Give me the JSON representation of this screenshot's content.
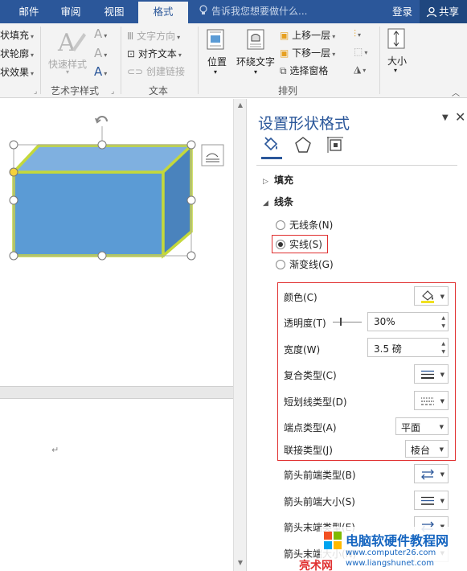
{
  "tabs": [
    {
      "label": "邮件",
      "active": false
    },
    {
      "label": "审阅",
      "active": false
    },
    {
      "label": "视图",
      "active": false
    },
    {
      "label": "格式",
      "active": true
    }
  ],
  "tell_me": "告诉我您想要做什么...",
  "login": "登录",
  "share": "共享",
  "ribbon": {
    "shape_styles": {
      "fill": "状填充",
      "outline": "状轮廓",
      "effects": "状效果"
    },
    "wordart": {
      "quick_styles": "快速样式",
      "group": "艺术字样式"
    },
    "text": {
      "direction": "文字方向",
      "align": "对齐文本",
      "link": "创建链接",
      "group": "文本"
    },
    "arrange": {
      "position": "位置",
      "wrap": "环绕文字",
      "forward": "上移一层",
      "backward": "下移一层",
      "pane": "选择窗格",
      "group": "排列"
    },
    "size": {
      "label": "大小"
    }
  },
  "pane": {
    "title": "设置形状格式",
    "sections": {
      "fill": "填充",
      "line": "线条"
    },
    "line_options": [
      {
        "label": "无线条(N)",
        "selected": false
      },
      {
        "label": "实线(S)",
        "selected": true
      },
      {
        "label": "渐变线(G)",
        "selected": false
      }
    ],
    "props": {
      "color": "颜色(C)",
      "transparency": "透明度(T)",
      "transparency_value": "30%",
      "width": "宽度(W)",
      "width_value": "3.5 磅",
      "compound": "复合类型(C)",
      "dash": "短划线类型(D)",
      "cap": "端点类型(A)",
      "cap_value": "平面",
      "join": "联接类型(J)",
      "join_value": "棱台",
      "arrow_begin_type": "箭头前端类型(B)",
      "arrow_begin_size": "箭头前端大小(S)",
      "arrow_end_type": "箭头末端类型(E)",
      "arrow_end_size": "箭头末端大小(N)"
    }
  },
  "watermark": {
    "title": "电脑软硬件教程网",
    "url1": "www.computer26.com",
    "url2": "www.liangshunet.com",
    "red": "亮术网"
  },
  "colors": {
    "accent": "#2b579a",
    "highlight": "#e03030",
    "shape_fill": "#5b9bd5",
    "shape_outline": "#c4d83b"
  }
}
